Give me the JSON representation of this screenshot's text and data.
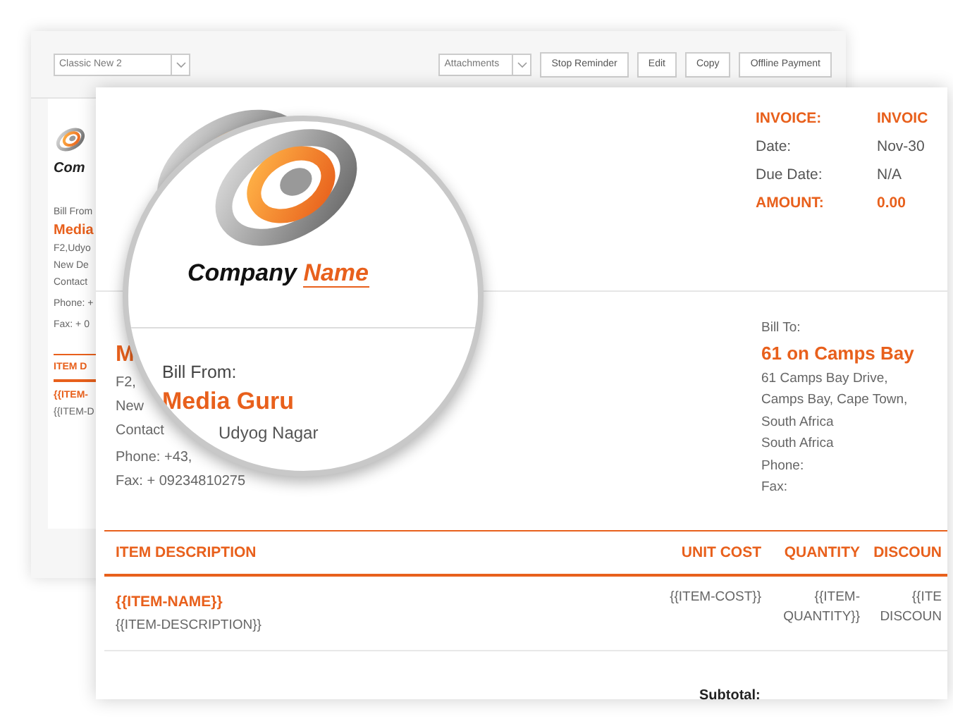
{
  "back_window": {
    "template_select": {
      "value": "Classic New 2"
    },
    "attachments_select": {
      "value": "Attachments"
    },
    "buttons": [
      "Stop Reminder",
      "Edit",
      "Copy",
      "Offline Payment"
    ],
    "logo_text": "Com",
    "bill_from_label": "Bill From",
    "company": "Media",
    "address_lines": [
      "F2,Udyo",
      "New De",
      "Contact"
    ],
    "phone": "Phone: +",
    "fax": "Fax: + 0",
    "table_header": "ITEM D",
    "item_name": "{{ITEM-",
    "item_description": "{{ITEM-D"
  },
  "invoice": {
    "meta": [
      {
        "label": "INVOICE:",
        "value": "INVOIC",
        "kind": "accent"
      },
      {
        "label": "Date:",
        "value": "Nov-30",
        "kind": "plain"
      },
      {
        "label": "Due Date:",
        "value": "N/A",
        "kind": "plain"
      },
      {
        "label": "AMOUNT:",
        "value": "0.00",
        "kind": "accent"
      }
    ],
    "bill_from": {
      "company": "M",
      "address_lines": [
        "F2,",
        "New",
        "Contact"
      ],
      "phone": "Phone: +43,",
      "fax": "Fax: + 09234810275"
    },
    "bill_to": {
      "label": "Bill To:",
      "name": "61 on Camps Bay",
      "lines": [
        "61 Camps Bay Drive,",
        "Camps Bay, Cape Town,",
        "South Africa",
        "South Africa",
        "Phone:",
        "Fax:"
      ]
    },
    "table": {
      "columns": [
        "ITEM DESCRIPTION",
        "UNIT COST",
        "QUANTITY",
        "DISCOUN"
      ],
      "rows": [
        {
          "item_name": "{{ITEM-NAME}}",
          "item_description": "{{ITEM-DESCRIPTION}}",
          "unit_cost": [
            "{{ITEM-COST}}"
          ],
          "quantity": [
            "{{ITEM-",
            "QUANTITY}}"
          ],
          "discount": [
            "{{ITE",
            "DISCOUN"
          ]
        }
      ]
    },
    "subtotal_label": "Subtotal:"
  },
  "magnifier": {
    "company_name": "Company",
    "company_name_accent": "Name",
    "bill_from_label": "Bill From:",
    "company": "Media Guru",
    "address_fragment": "Udyog Nagar"
  }
}
